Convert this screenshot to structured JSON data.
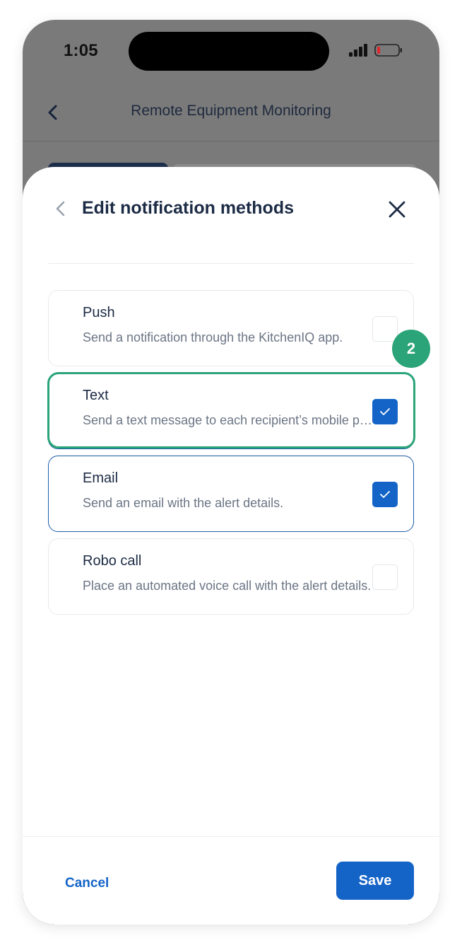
{
  "status_bar": {
    "time": "1:05",
    "signal_icon": "cellular-signal-icon",
    "battery_icon": "battery-low-icon"
  },
  "background_screen": {
    "title": "Remote Equipment Monitoring",
    "back_icon": "chevron-left-icon"
  },
  "sheet": {
    "title": "Edit notification methods",
    "back_icon": "chevron-left-icon",
    "close_icon": "close-icon",
    "options": [
      {
        "title": "Push",
        "description": "Send a notification through the KitchenIQ app.",
        "checked": false
      },
      {
        "title": "Text",
        "description": "Send a text message to each recipient’s mobile phone.",
        "checked": true
      },
      {
        "title": "Email",
        "description": "Send an email with the alert details.",
        "checked": true
      },
      {
        "title": "Robo call",
        "description": "Place an automated voice call with the alert details.",
        "checked": false
      }
    ],
    "cancel_label": "Cancel",
    "save_label": "Save"
  },
  "step_badge": "2",
  "colors": {
    "primary": "#1464c8",
    "highlight": "#2aa478",
    "title_text": "#1c2b45",
    "muted_text": "#6b7585",
    "overlay": "#7a7a7a"
  }
}
